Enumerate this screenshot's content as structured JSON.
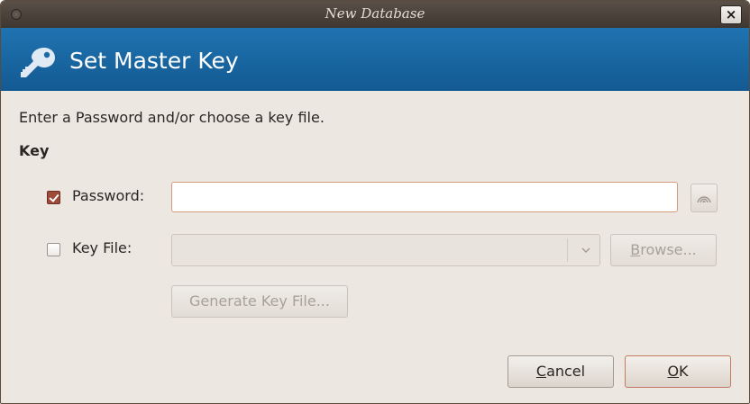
{
  "window": {
    "title": "New Database",
    "close_glyph": "×"
  },
  "banner": {
    "title": "Set Master Key",
    "icon": "key-icon",
    "color": "#1a6aa6"
  },
  "instruction": "Enter a Password and/or choose a key file.",
  "section_title": "Key",
  "password": {
    "checked": true,
    "label": "Password:",
    "value": "",
    "reveal_icon": "eye-icon"
  },
  "key_file": {
    "checked": false,
    "label": "Key File:",
    "value": "",
    "browse_label_mnemonic": "B",
    "browse_label_rest": "rowse...",
    "browse_enabled": false
  },
  "generate_key_file_label": "Generate Key File...",
  "buttons": {
    "cancel_mnemonic": "C",
    "cancel_rest": "ancel",
    "ok_mnemonic": "O",
    "ok_rest": "K"
  },
  "colors": {
    "checkbox_checked": "#9e4b3a",
    "default_button_border": "#c27a63"
  }
}
